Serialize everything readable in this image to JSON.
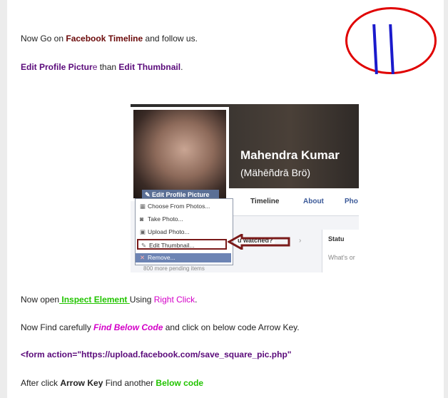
{
  "lines": {
    "l1": {
      "pre": "Now Go on ",
      "strong": "Facebook Timeline",
      "post": " and follow us."
    },
    "l2": {
      "a": "Edit Profile Pictur",
      "b": "e ",
      "c": "than",
      "d": " Edit Thumbnail",
      "e": "."
    },
    "l3": {
      "pre": "Now open",
      "link": " Inspect Element ",
      "mid": "Using ",
      "rc": "Right Click",
      "post": "."
    },
    "l4": {
      "pre": "Now Find carefully ",
      "em": "Find Below Code",
      "post": " and click on below code Arrow Key."
    },
    "l5": {
      "code": "<form action=\"https://upload.facebook.com/save_square_pic.php\""
    },
    "l6": {
      "pre": "After click ",
      "strong": "Arrow Key",
      "mid": " Find another ",
      "green": "Below code"
    }
  },
  "screenshot": {
    "name": "Mahendra Kumar",
    "alias": "(Mähēñdrā Brö)",
    "edit_profile_picture": "✎ Edit Profile Picture",
    "tabs": [
      "Timeline",
      "About",
      "Pho"
    ],
    "menu": [
      "Choose From Photos...",
      "Take Photo...",
      "Upload Photo...",
      "Edit Thumbnail...",
      "Remove..."
    ],
    "pending": "800 more pending items",
    "watched": "u watched?",
    "status": "Statu",
    "whats": "What's or"
  },
  "colors": {
    "circle": "#e00000",
    "bars": "#1a1acc",
    "arrow": "#7a1a1a"
  }
}
